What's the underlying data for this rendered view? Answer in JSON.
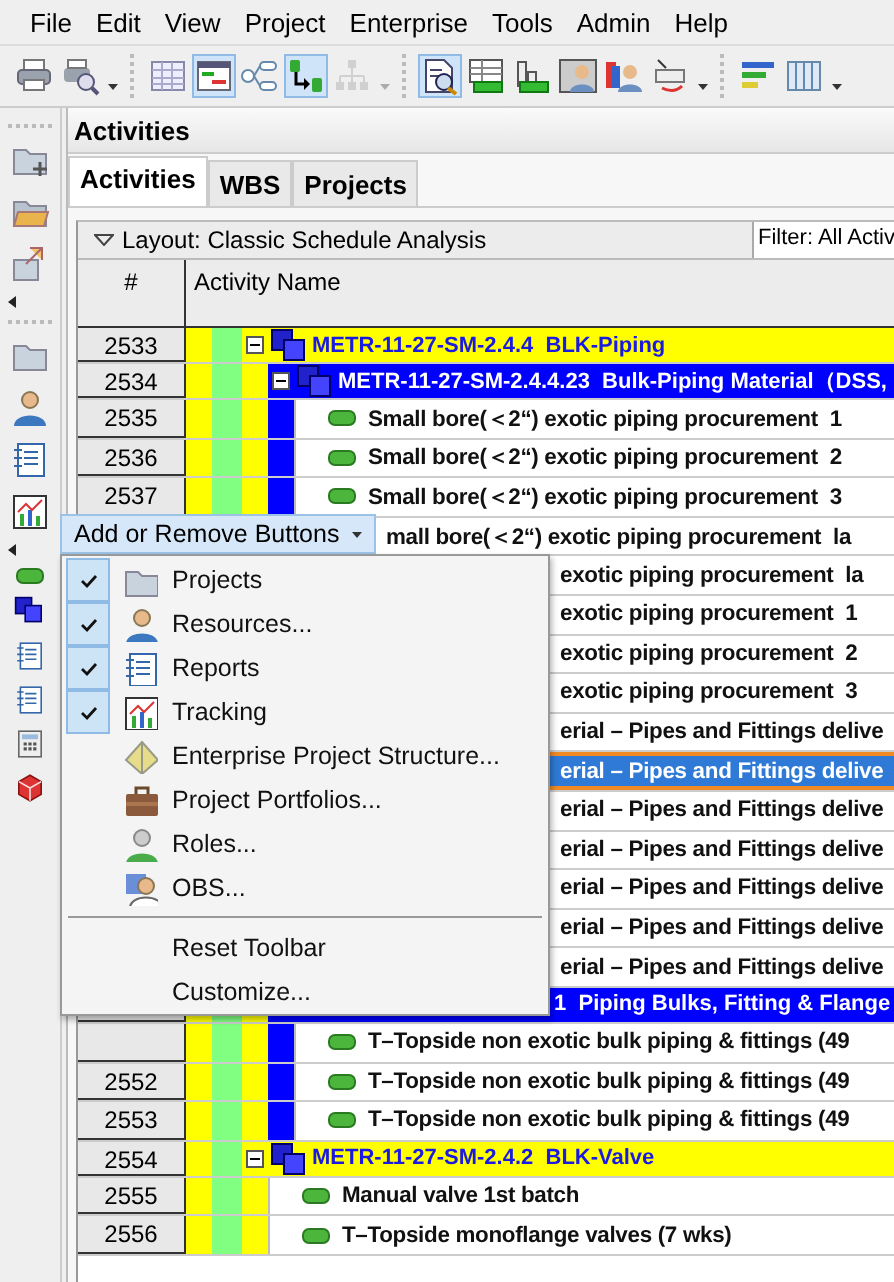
{
  "menu_bar": [
    "File",
    "Edit",
    "View",
    "Project",
    "Enterprise",
    "Tools",
    "Admin",
    "Help"
  ],
  "toolbar": [
    {
      "kind": "button",
      "selected": false,
      "disabled": false,
      "menu": false
    },
    {
      "kind": "button",
      "selected": false,
      "disabled": false,
      "menu": true
    },
    {
      "kind": "separator"
    },
    {
      "kind": "button",
      "selected": false,
      "disabled": false,
      "menu": false
    },
    {
      "kind": "button",
      "selected": true,
      "disabled": false,
      "menu": false
    },
    {
      "kind": "button",
      "selected": false,
      "disabled": false,
      "menu": false
    },
    {
      "kind": "button",
      "selected": true,
      "disabled": false,
      "menu": false
    },
    {
      "kind": "button",
      "selected": false,
      "disabled": true,
      "menu": true
    },
    {
      "kind": "separator"
    },
    {
      "kind": "button",
      "selected": true,
      "disabled": false,
      "menu": false
    },
    {
      "kind": "button",
      "selected": false,
      "disabled": false,
      "menu": false
    },
    {
      "kind": "button",
      "selected": false,
      "disabled": false,
      "menu": false
    },
    {
      "kind": "button",
      "selected": false,
      "disabled": false,
      "menu": false
    },
    {
      "kind": "button",
      "selected": false,
      "disabled": false,
      "menu": false
    },
    {
      "kind": "button",
      "selected": false,
      "disabled": false,
      "menu": true
    },
    {
      "kind": "separator"
    },
    {
      "kind": "button",
      "selected": false,
      "disabled": false,
      "menu": false
    },
    {
      "kind": "button",
      "selected": false,
      "disabled": false,
      "menu": true
    }
  ],
  "panel": {
    "title": "Activities",
    "tabs": [
      {
        "label": "Activities",
        "selected": true
      },
      {
        "label": "WBS",
        "selected": false
      },
      {
        "label": "Projects",
        "selected": false
      }
    ],
    "layout": "Layout: Classic Schedule Analysis",
    "filter": "Filter: All Activ",
    "columns": [
      "#",
      "Activity Name"
    ],
    "rows": [
      {
        "number": "2533",
        "kind": "wbs",
        "name": "METR-11-27-SM-2.4.4  BLK-Piping",
        "color": "#ffff00",
        "expanded": true,
        "selected": false,
        "children": [
          {
            "number": "2534",
            "kind": "wbs",
            "name": "METR-11-27-SM-2.4.4.23  Bulk-Piping Material（DSS,",
            "color": "#0000ff",
            "expanded": true,
            "selected": false,
            "children": [
              {
                "number": "2535",
                "kind": "activity",
                "name": "Small bore(＜2“) exotic piping procurement  1",
                "selected": false
              },
              {
                "number": "2536",
                "kind": "activity",
                "name": "Small bore(＜2“) exotic piping procurement  2",
                "selected": false
              },
              {
                "number": "2537",
                "kind": "activity",
                "name": "Small bore(＜2“) exotic piping procurement  3",
                "selected": false
              },
              {
                "kind": "activity",
                "under_button": true,
                "name": "mall bore(＜2“) exotic piping procurement  la",
                "selected": false
              },
              {
                "kind": "activity",
                "under_menu": true,
                "name": "exotic piping procurement  la",
                "selected": false
              },
              {
                "kind": "activity",
                "under_menu": true,
                "name": "exotic piping procurement  1",
                "selected": false
              },
              {
                "kind": "activity",
                "under_menu": true,
                "name": "exotic piping procurement  2",
                "selected": false
              },
              {
                "kind": "activity",
                "under_menu": true,
                "name": "exotic piping procurement  3",
                "selected": false
              },
              {
                "kind": "activity",
                "under_menu": true,
                "name": "erial – Pipes and Fittings delive",
                "selected": false
              },
              {
                "kind": "activity",
                "under_menu": true,
                "name": "erial – Pipes and Fittings delive",
                "selected": true
              },
              {
                "kind": "activity",
                "under_menu": true,
                "name": "erial – Pipes and Fittings delive",
                "selected": false
              },
              {
                "kind": "activity",
                "under_menu": true,
                "name": "erial – Pipes and Fittings delive",
                "selected": false
              },
              {
                "kind": "activity",
                "under_menu": true,
                "name": "erial – Pipes and Fittings delive",
                "selected": false
              },
              {
                "kind": "activity",
                "under_menu": true,
                "name": "erial – Pipes and Fittings delive",
                "selected": false
              },
              {
                "kind": "activity",
                "under_menu": true,
                "name": "erial – Pipes and Fittings delive",
                "selected": false
              }
            ]
          },
          {
            "kind": "wbs",
            "under_menu": true,
            "name": "1  Piping Bulks, Fitting & Flange",
            "color": "#0000ff",
            "expanded": true,
            "selected": false,
            "children": [
              {
                "kind": "activity",
                "name": "T–Topside non exotic bulk piping & fittings (49",
                "selected": false
              },
              {
                "number": "2552",
                "kind": "activity",
                "name": "T–Topside non exotic bulk piping & fittings (49",
                "selected": false
              },
              {
                "number": "2553",
                "kind": "activity",
                "name": "T–Topside non exotic bulk piping & fittings (49",
                "selected": false
              }
            ]
          }
        ]
      },
      {
        "number": "2554",
        "kind": "wbs",
        "name": "METR-11-27-SM-2.4.2  BLK-Valve",
        "color": "#ffff00",
        "expanded": true,
        "selected": false,
        "children": [
          {
            "number": "2555",
            "kind": "activity",
            "name": "Manual valve 1st batch",
            "selected": false
          },
          {
            "number": "2556",
            "kind": "activity",
            "name": "T–Topside monoflange valves (7 wks)",
            "selected": false
          }
        ]
      }
    ]
  },
  "popup": {
    "button": "Add or Remove Buttons",
    "items": [
      {
        "kind": "item",
        "label": "Projects",
        "checked": true
      },
      {
        "kind": "item",
        "label": "Resources...",
        "checked": true
      },
      {
        "kind": "item",
        "label": "Reports",
        "checked": true
      },
      {
        "kind": "item",
        "label": "Tracking",
        "checked": true
      },
      {
        "kind": "item",
        "label": "Enterprise Project Structure...",
        "checked": false
      },
      {
        "kind": "item",
        "label": "Project Portfolios...",
        "checked": false
      },
      {
        "kind": "item",
        "label": "Roles...",
        "checked": false
      },
      {
        "kind": "item",
        "label": "OBS...",
        "checked": false
      },
      {
        "kind": "separator"
      },
      {
        "kind": "item",
        "label": "Reset Toolbar",
        "checked": false
      },
      {
        "kind": "item",
        "label": "Customize...",
        "checked": false
      }
    ]
  }
}
